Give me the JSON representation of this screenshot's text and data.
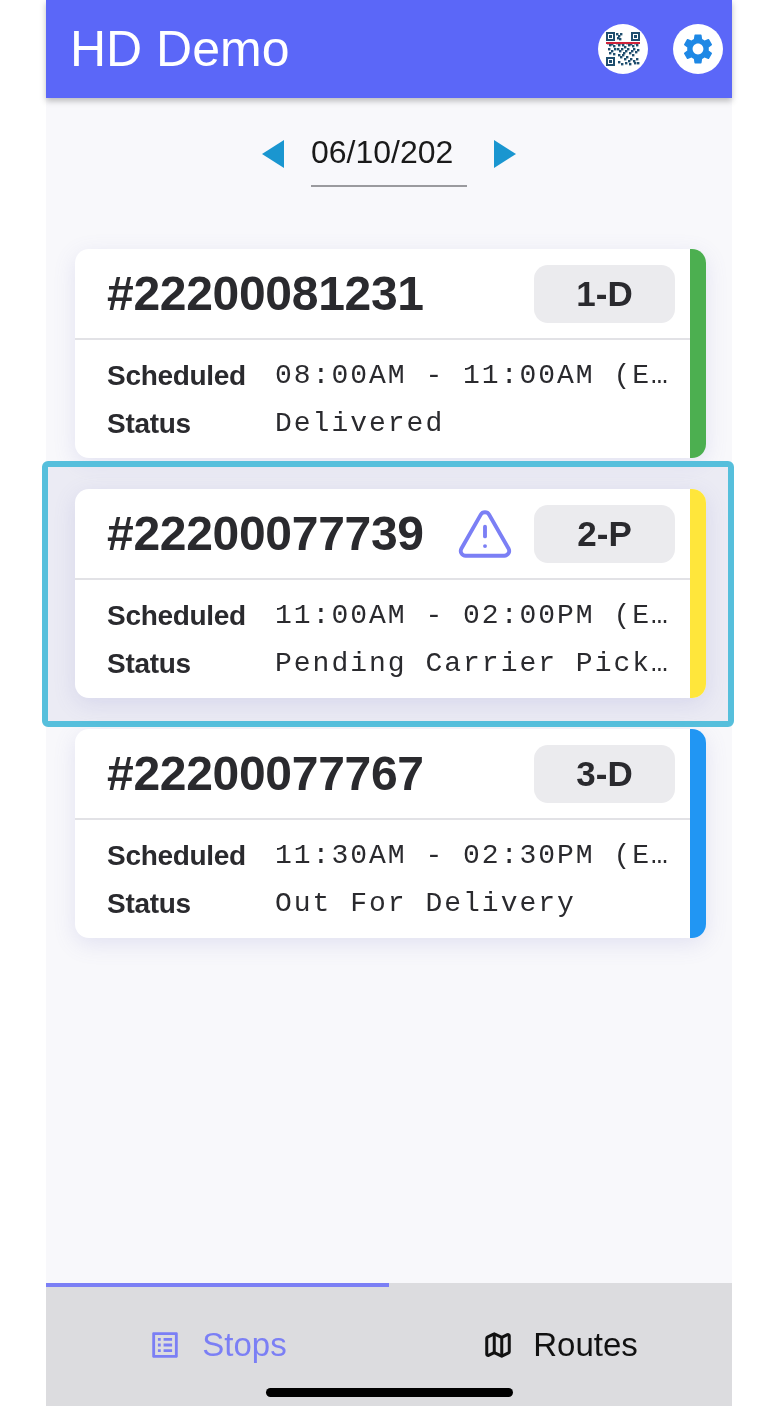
{
  "app_bar": {
    "title": "HD Demo"
  },
  "date_picker": {
    "value": "06/10/202"
  },
  "stops": [
    {
      "number": "#22200081231",
      "warning": false,
      "badge": "1-D",
      "color": "#4caf50",
      "selected": false,
      "fields": [
        {
          "label": "Scheduled",
          "value": "08:00AM - 11:00AM (E…"
        },
        {
          "label": "Status",
          "value": "Delivered"
        }
      ]
    },
    {
      "number": "#22200077739",
      "warning": true,
      "badge": "2-P",
      "color": "#ffe63b",
      "selected": true,
      "fields": [
        {
          "label": "Scheduled",
          "value": "11:00AM - 02:00PM (E…"
        },
        {
          "label": "Status",
          "value": "Pending Carrier Pick…"
        }
      ]
    },
    {
      "number": "#22200077767",
      "warning": false,
      "badge": "3-D",
      "color": "#2196f3",
      "selected": false,
      "fields": [
        {
          "label": "Scheduled",
          "value": "11:30AM - 02:30PM (E…"
        },
        {
          "label": "Status",
          "value": "Out For Delivery"
        }
      ]
    }
  ],
  "tabs": [
    {
      "label": "Stops",
      "selected": true
    },
    {
      "label": "Routes",
      "selected": false
    }
  ]
}
